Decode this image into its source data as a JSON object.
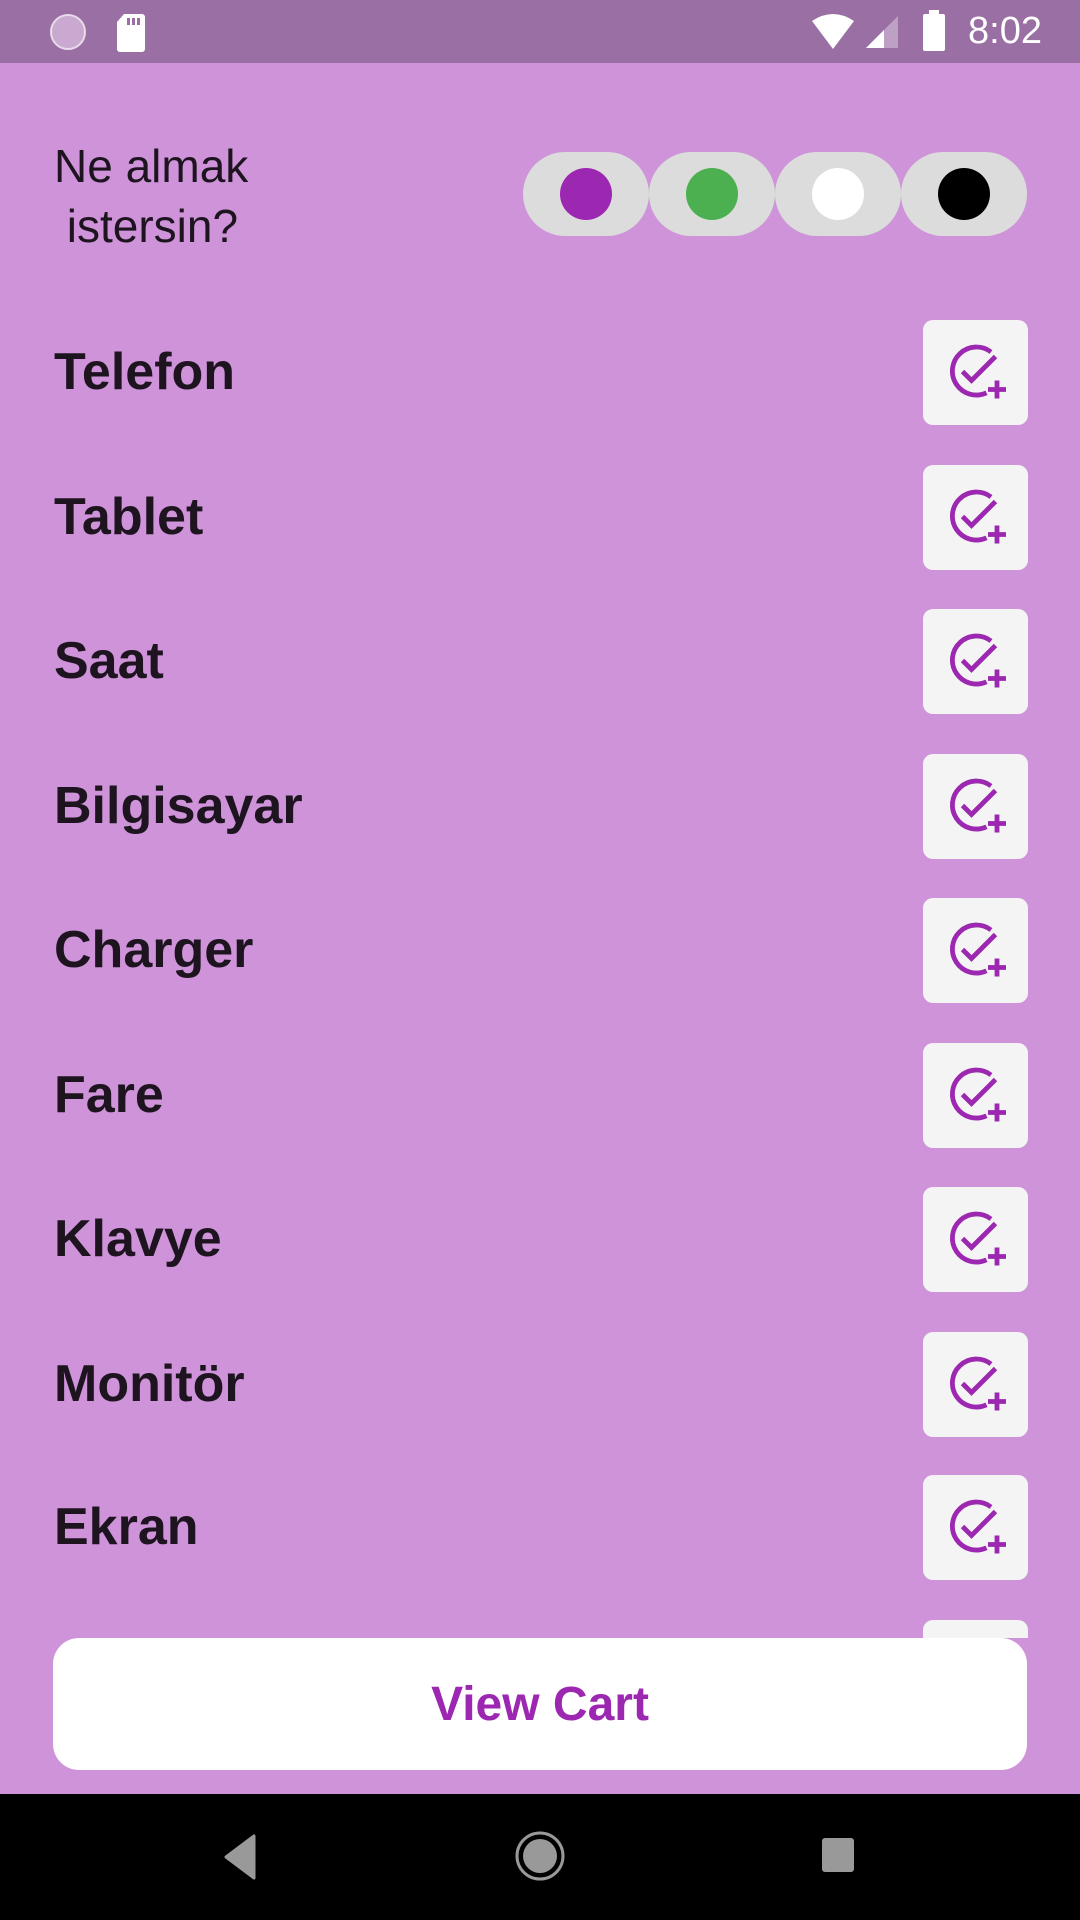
{
  "status_bar": {
    "time": "8:02",
    "icons": [
      "loading-icon",
      "sd-card-icon",
      "wifi-icon",
      "signal-icon",
      "battery-icon"
    ]
  },
  "header": {
    "title": "Ne almak\n istersin?"
  },
  "colors": {
    "background": "#CE93D8",
    "accent": "#9C27B0",
    "theme_options": [
      "#9C27B0",
      "#4CAF50",
      "#FFFFFF",
      "#000000"
    ]
  },
  "items": [
    {
      "label": "Telefon"
    },
    {
      "label": "Tablet"
    },
    {
      "label": "Saat"
    },
    {
      "label": "Bilgisayar"
    },
    {
      "label": "Charger"
    },
    {
      "label": "Fare"
    },
    {
      "label": "Klavye"
    },
    {
      "label": "Monitör"
    },
    {
      "label": "Ekran"
    }
  ],
  "add_icon": "check-circle-plus-icon",
  "cart_button": {
    "label": "View Cart"
  },
  "nav_bar": {
    "icons": [
      "back-icon",
      "home-icon",
      "recents-icon"
    ]
  }
}
